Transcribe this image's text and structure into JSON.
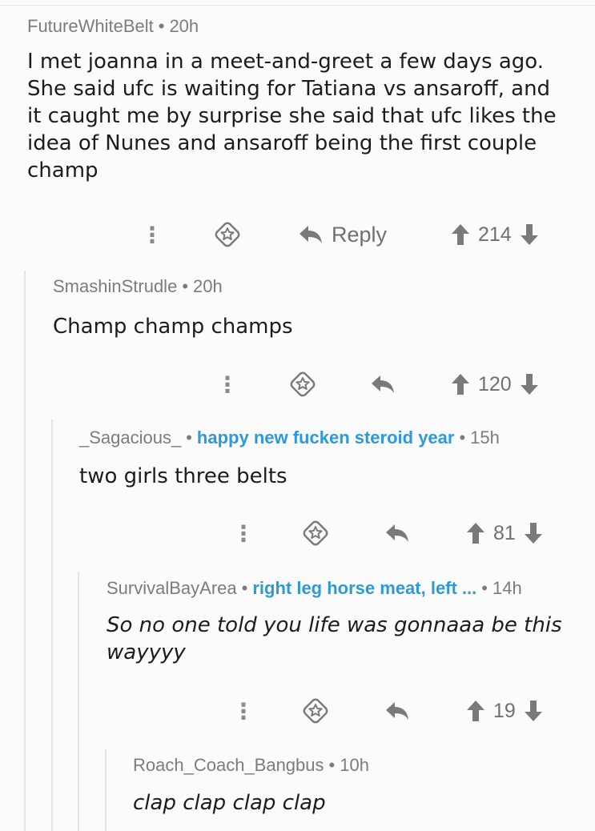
{
  "comments": [
    {
      "author": "FutureWhiteBelt",
      "flair": "",
      "age": "20h",
      "lines": [
        "I met joanna in a meet-and-greet a few days ago.",
        "She said ufc is waiting for Tatiana vs ansaroff, and",
        "it caught me by surprise she said that ufc likes the",
        "idea of Nunes and ansaroff being the first couple",
        "champ"
      ],
      "reply_label": "Reply",
      "score": "214"
    },
    {
      "author": "SmashinStrudle",
      "flair": "",
      "age": "20h",
      "lines": [
        "Champ champ champs"
      ],
      "score": "120"
    },
    {
      "author": "_Sagacious_",
      "flair": "happy new fucken steroid year",
      "age": "15h",
      "lines": [
        "two girls three belts"
      ],
      "score": "81"
    },
    {
      "author": "SurvivalBayArea",
      "flair": "right leg horse meat, left ...",
      "age": "14h",
      "lines": [
        "So no one told you life was gonnaaa be this",
        "wayyyy"
      ],
      "score": "19"
    },
    {
      "author": "Roach_Coach_Bangbus",
      "flair": "",
      "age": "10h",
      "lines": [
        "clap clap clap clap"
      ]
    }
  ],
  "separator": "•",
  "icons": [
    "more-options-icon",
    "award-icon",
    "reply-icon",
    "upvote-icon",
    "downvote-icon"
  ]
}
